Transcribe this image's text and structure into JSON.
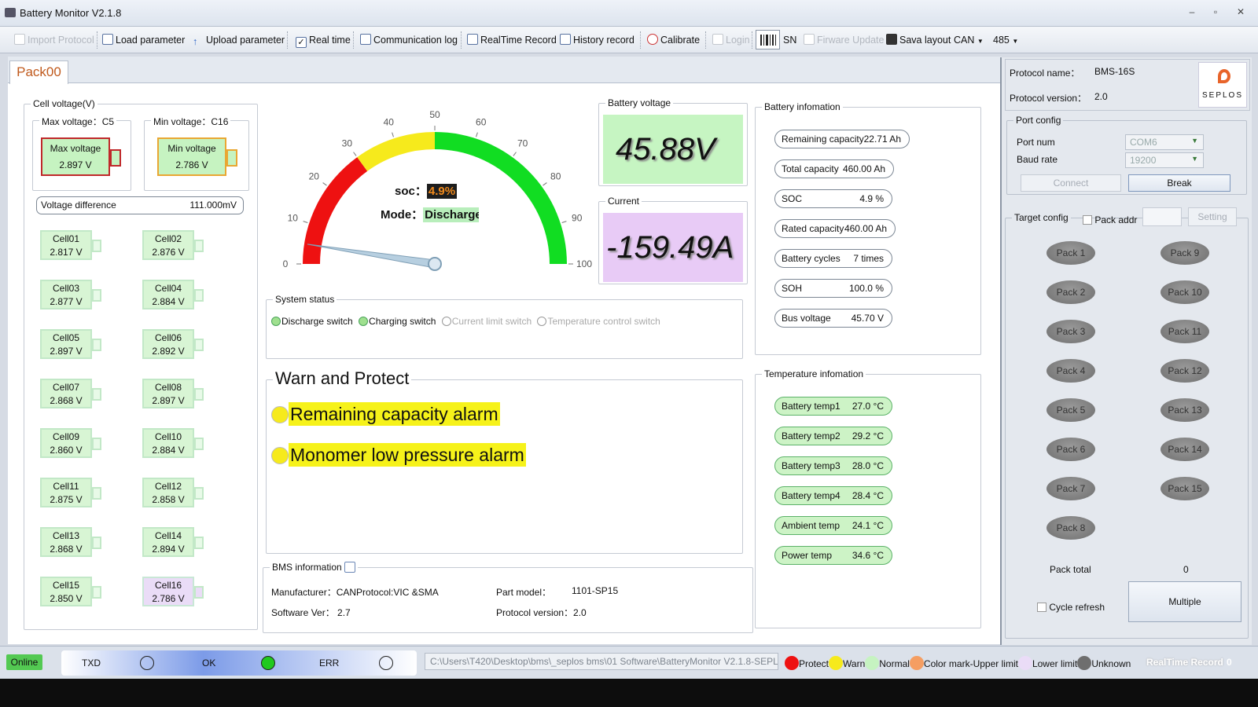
{
  "window": {
    "title": "Battery Monitor V2.1.8",
    "min": "–",
    "restore": "▫",
    "close": "✕"
  },
  "toolbar": {
    "import_protocol": "Import Protocol",
    "load_parameter": "Load parameter",
    "upload_parameter": "Upload parameter",
    "real_time": "Real time",
    "communication_log": "Communication log",
    "realtime_record": "RealTime Record",
    "history_record": "History record",
    "calibrate": "Calibrate",
    "login": "Login",
    "sn": "SN",
    "firmware_update": "Firware Update",
    "save_layout": "Sava layout",
    "can": "CAN",
    "rs485": "485"
  },
  "tab": {
    "label": "Pack00"
  },
  "cell_voltage": {
    "title": "Cell voltage(V)",
    "max_title": "Max voltage：C5",
    "max_label": "Max voltage",
    "max_value": "2.897 V",
    "min_title": "Min voltage：C16",
    "min_label": "Min voltage",
    "min_value": "2.786 V",
    "diff_label": "Voltage difference",
    "diff_value": "111.000mV",
    "cells": [
      {
        "name": "Cell01",
        "value": "2.817 V"
      },
      {
        "name": "Cell02",
        "value": "2.876 V"
      },
      {
        "name": "Cell03",
        "value": "2.877 V"
      },
      {
        "name": "Cell04",
        "value": "2.884 V"
      },
      {
        "name": "Cell05",
        "value": "2.897 V"
      },
      {
        "name": "Cell06",
        "value": "2.892 V"
      },
      {
        "name": "Cell07",
        "value": "2.868 V"
      },
      {
        "name": "Cell08",
        "value": "2.897 V"
      },
      {
        "name": "Cell09",
        "value": "2.860 V"
      },
      {
        "name": "Cell10",
        "value": "2.884 V"
      },
      {
        "name": "Cell11",
        "value": "2.875 V"
      },
      {
        "name": "Cell12",
        "value": "2.858 V"
      },
      {
        "name": "Cell13",
        "value": "2.868 V"
      },
      {
        "name": "Cell14",
        "value": "2.894 V"
      },
      {
        "name": "Cell15",
        "value": "2.850 V"
      },
      {
        "name": "Cell16",
        "value": "2.786 V"
      }
    ]
  },
  "gauge": {
    "ticks": [
      "0",
      "10",
      "20",
      "30",
      "40",
      "50",
      "60",
      "70",
      "80",
      "90",
      "100"
    ],
    "soc_label": "soc：",
    "soc_value": "4.9%",
    "soc_percent": 4.9,
    "mode_label": "Mode：",
    "mode_value": "Discharge",
    "colors": {
      "red": "#ee1111",
      "yellow": "#f6ea1c",
      "green": "#11dd22"
    }
  },
  "battery_voltage": {
    "title": "Battery voltage",
    "value": "45.88V"
  },
  "current": {
    "title": "Current",
    "value": "-159.49A"
  },
  "battery_info": {
    "title": "Battery infomation",
    "items": [
      {
        "label": "Remaining capacity",
        "value": "22.71 Ah"
      },
      {
        "label": "Total capacity",
        "value": "460.00 Ah"
      },
      {
        "label": "SOC",
        "value": "4.9 %"
      },
      {
        "label": "Rated capacity",
        "value": "460.00 Ah"
      },
      {
        "label": "Battery cycles",
        "value": "7 times"
      },
      {
        "label": "SOH",
        "value": "100.0 %"
      },
      {
        "label": "Bus voltage",
        "value": "45.70 V"
      }
    ]
  },
  "system_status": {
    "title": "System status",
    "discharge": "Discharge switch",
    "charging": "Charging switch",
    "current_limit": "Current limit switch",
    "temp_control": "Temperature control switch"
  },
  "warn": {
    "title": "Warn and Protect",
    "alarms": [
      "Remaining capacity alarm",
      "Monomer low pressure alarm"
    ]
  },
  "temperature": {
    "title": "Temperature infomation",
    "items": [
      {
        "label": "Battery temp1",
        "value": "27.0 °C"
      },
      {
        "label": "Battery temp2",
        "value": "29.2 °C"
      },
      {
        "label": "Battery temp3",
        "value": "28.0 °C"
      },
      {
        "label": "Battery temp4",
        "value": "28.4 °C"
      },
      {
        "label": "Ambient temp",
        "value": "24.1 °C"
      },
      {
        "label": "Power temp",
        "value": "34.6 °C"
      }
    ]
  },
  "bms": {
    "title": "BMS information",
    "manufacturer_label": "Manufacturer：",
    "manufacturer": "CANProtocol:VIC &SMA",
    "part_model_label": "Part model：",
    "part_model": "1101-SP15",
    "software_label": "Software Ver：",
    "software": "2.7",
    "protocol_label": "Protocol version：",
    "protocol": "2.0"
  },
  "right": {
    "protocol_name_label": "Protocol name：",
    "protocol_name": "BMS-16S",
    "protocol_version_label": "Protocol version：",
    "protocol_version": "2.0",
    "logo": "SEPLOS",
    "port_config": "Port config",
    "port_num_label": "Port num",
    "port_num": "COM6",
    "baud_label": "Baud rate",
    "baud": "19200",
    "connect": "Connect",
    "break": "Break",
    "target_config": "Target config",
    "pack_addr": "Pack addr",
    "setting": "Setting",
    "packs": [
      "Pack 1",
      "Pack 2",
      "Pack 3",
      "Pack 4",
      "Pack 5",
      "Pack 6",
      "Pack 7",
      "Pack 8",
      "Pack 9",
      "Pack 10",
      "Pack 11",
      "Pack 12",
      "Pack 13",
      "Pack 14",
      "Pack 15"
    ],
    "pack_total_label": "Pack total",
    "pack_total": "0",
    "cycle_refresh": "Cycle refresh",
    "multiple": "Multiple"
  },
  "status": {
    "online": "Online",
    "txd": "TXD",
    "ok": "OK",
    "err": "ERR",
    "path": "C:\\Users\\T420\\Desktop\\bms\\_seplos bms\\01 Software\\BatteryMonitor V2.1.8-SEPLO",
    "legend": [
      "Protect",
      "Warn",
      "Normal",
      "Color mark-Upper limit",
      "Lower limit",
      "Unknown"
    ],
    "legend_colors": [
      "#ee1111",
      "#f6ea1c",
      "#c6f3c1",
      "#f59e62",
      "#eadcf7",
      "#6e6e6e"
    ],
    "realtime_record": "RealTime Record",
    "record_count": "0"
  }
}
